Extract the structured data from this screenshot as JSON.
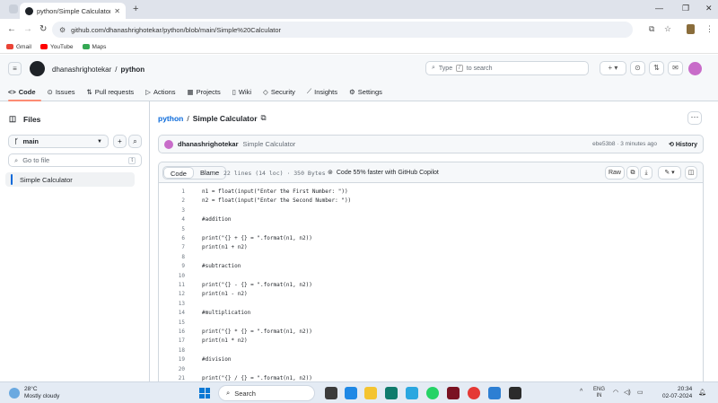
{
  "browser": {
    "tab_title": "python/Simple Calculator at m",
    "address_url": "github.com/dhanashrighotekar/python/blob/main/Simple%20Calculator",
    "bookmarks": [
      {
        "label": "Gmail",
        "color": "#ea4335"
      },
      {
        "label": "YouTube",
        "color": "#ff0000"
      },
      {
        "label": "Maps",
        "color": "#34a853"
      }
    ]
  },
  "header": {
    "owner": "dhanashrighotekar",
    "separator": "/",
    "repo": "python",
    "search_placeholder": "Type",
    "search_key": "/",
    "search_suffix": "to search"
  },
  "repo_nav": [
    {
      "label": "Code",
      "icon": "code-icon"
    },
    {
      "label": "Issues",
      "icon": "issue-icon"
    },
    {
      "label": "Pull requests",
      "icon": "pull-request-icon"
    },
    {
      "label": "Actions",
      "icon": "play-icon"
    },
    {
      "label": "Projects",
      "icon": "table-icon"
    },
    {
      "label": "Wiki",
      "icon": "book-icon"
    },
    {
      "label": "Security",
      "icon": "shield-icon"
    },
    {
      "label": "Insights",
      "icon": "graph-icon"
    },
    {
      "label": "Settings",
      "icon": "gear-icon"
    }
  ],
  "sidebar": {
    "title": "Files",
    "branch": "main",
    "goto_placeholder": "Go to file",
    "goto_key": "t",
    "file": "Simple Calculator"
  },
  "file": {
    "repo_link": "python",
    "separator": "/",
    "name": "Simple Calculator",
    "commit_user": "dhanashrighotekar",
    "commit_message": "Simple Calculator",
    "commit_meta": "ebe53b8 · 3 minutes ago",
    "history_label": "History",
    "view_code": "Code",
    "view_blame": "Blame",
    "stats": "22 lines (14 loc) · 350 Bytes",
    "copilot": "Code 55% faster with GitHub Copilot",
    "raw_label": "Raw"
  },
  "code_lines": [
    {
      "n": "1",
      "t": "n1 = float(input(\"Enter the First Number: \"))"
    },
    {
      "n": "2",
      "t": "n2 = float(input(\"Enter the Second Number: \"))"
    },
    {
      "n": "3",
      "t": ""
    },
    {
      "n": "4",
      "t": "#addition"
    },
    {
      "n": "5",
      "t": ""
    },
    {
      "n": "6",
      "t": "print(\"{} + {} = \".format(n1, n2))"
    },
    {
      "n": "7",
      "t": "print(n1 + n2)"
    },
    {
      "n": "8",
      "t": ""
    },
    {
      "n": "9",
      "t": "#subtraction"
    },
    {
      "n": "10",
      "t": ""
    },
    {
      "n": "11",
      "t": "print(\"{} - {} = \".format(n1, n2))"
    },
    {
      "n": "12",
      "t": "print(n1 - n2)"
    },
    {
      "n": "13",
      "t": ""
    },
    {
      "n": "14",
      "t": "#multiplication"
    },
    {
      "n": "15",
      "t": ""
    },
    {
      "n": "16",
      "t": "print(\"{} * {} = \".format(n1, n2))"
    },
    {
      "n": "17",
      "t": "print(n1 * n2)"
    },
    {
      "n": "18",
      "t": ""
    },
    {
      "n": "19",
      "t": "#division"
    },
    {
      "n": "20",
      "t": ""
    },
    {
      "n": "21",
      "t": "print(\"{} / {} = \".format(n1, n2))"
    }
  ],
  "taskbar": {
    "temp": "28°C",
    "weather": "Mostly cloudy",
    "search": "Search",
    "lang1": "ENG",
    "lang2": "IN",
    "time": "20:34",
    "date": "02-07-2024"
  }
}
